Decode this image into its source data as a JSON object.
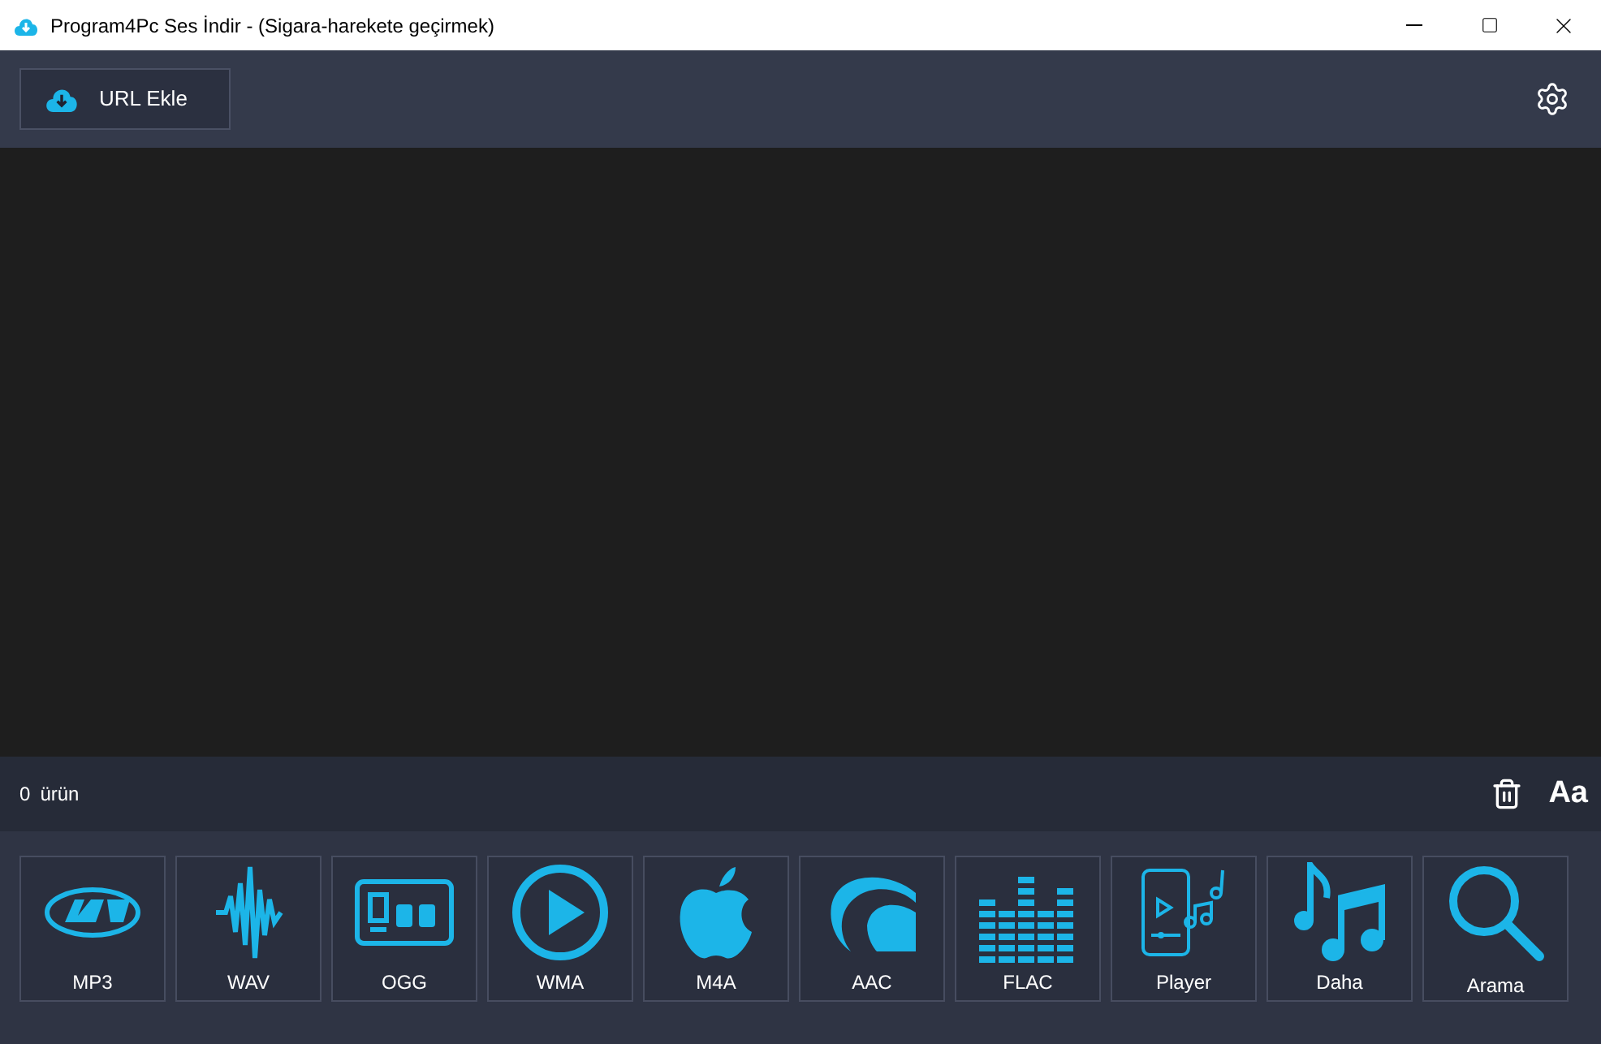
{
  "window": {
    "title": "Program4Pc Ses İndir - (Sigara-harekete geçirmek)"
  },
  "toolbar": {
    "add_button": "URL Ekle"
  },
  "status_bar": {
    "count": "0",
    "count_label": "ürün",
    "font_button": "Aa"
  },
  "formats": [
    {
      "label": "MP3"
    },
    {
      "label": "WAV"
    },
    {
      "label": "OGG"
    },
    {
      "label": "WMA"
    },
    {
      "label": "M4A"
    },
    {
      "label": "AAC"
    },
    {
      "label": "FLAC"
    },
    {
      "label": "Player"
    },
    {
      "label": "Daha"
    },
    {
      "label": "Arama"
    }
  ]
}
